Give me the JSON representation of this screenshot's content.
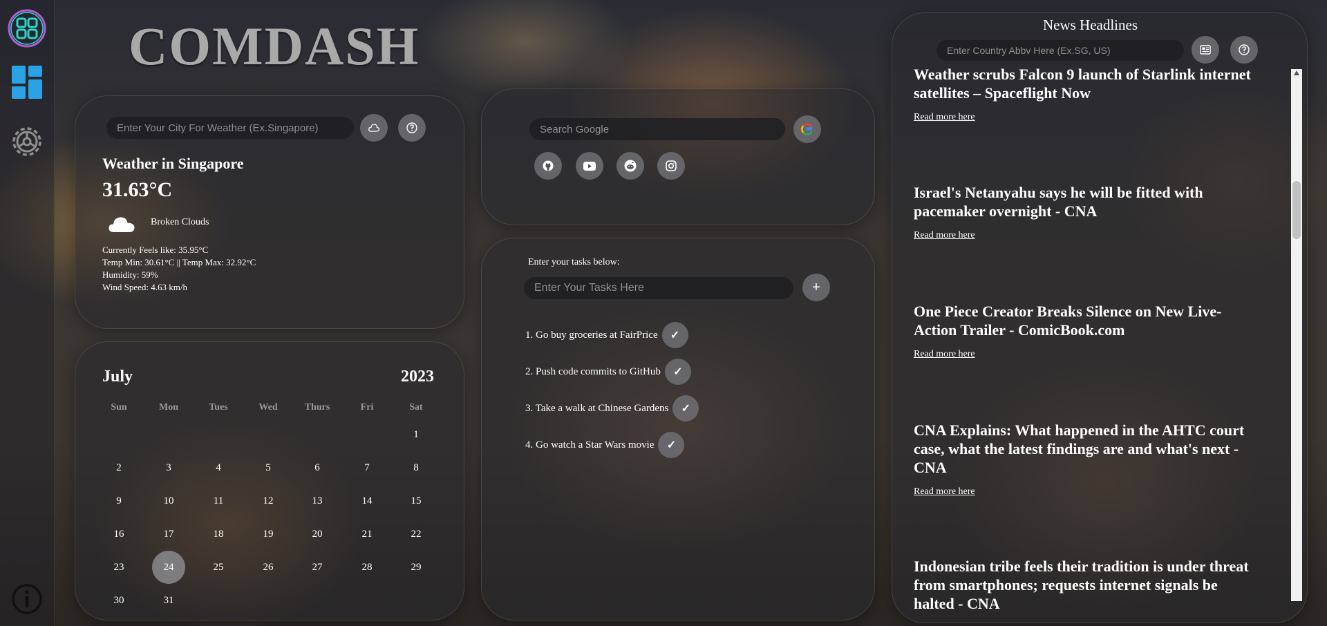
{
  "app": {
    "title": "COMDASH"
  },
  "sidebar": {
    "items": [
      {
        "name": "app-logo",
        "icon": "grid-logo-icon"
      },
      {
        "name": "dashboard",
        "icon": "dashboard-icon"
      },
      {
        "name": "settings",
        "icon": "gear-icon"
      },
      {
        "name": "info",
        "icon": "info-icon"
      }
    ]
  },
  "weather": {
    "placeholder": "Enter Your City For Weather (Ex.Singapore)",
    "title": "Weather in Singapore",
    "temp": "31.63°C",
    "condition": "Broken Clouds",
    "feels_like": "Currently Feels like: 35.95°C",
    "temp_range": "Temp Min: 30.61°C || Temp Max: 32.92°C",
    "humidity": "Humidity: 59%",
    "wind": "Wind Speed: 4.63 km/h"
  },
  "calendar": {
    "month": "July",
    "year": "2023",
    "weekdays": [
      "Sun",
      "Mon",
      "Tues",
      "Wed",
      "Thurs",
      "Fri",
      "Sat"
    ],
    "days": [
      "1",
      "2",
      "3",
      "4",
      "5",
      "6",
      "7",
      "8",
      "9",
      "10",
      "11",
      "12",
      "13",
      "14",
      "15",
      "16",
      "17",
      "18",
      "19",
      "20",
      "21",
      "22",
      "23",
      "24",
      "25",
      "26",
      "27",
      "28",
      "29",
      "30",
      "31"
    ],
    "today": "24"
  },
  "search": {
    "placeholder": "Search Google",
    "shortcuts": [
      "github-icon",
      "youtube-icon",
      "reddit-icon",
      "instagram-icon"
    ]
  },
  "tasks": {
    "label": "Enter your tasks below:",
    "placeholder": "Enter Your Tasks Here",
    "add_label": "+",
    "check_label": "✓",
    "items": [
      "1. Go buy groceries at FairPrice",
      "2. Push code commits to GitHub",
      "3. Take a walk at Chinese Gardens",
      "4. Go watch a Star Wars movie"
    ]
  },
  "news": {
    "title": "News Headlines",
    "placeholder": "Enter Country Abbv Here (Ex.SG, US)",
    "read_more": "Read more here",
    "articles": [
      "Weather scrubs Falcon 9 launch of Starlink internet satellites – Spaceflight Now",
      "Israel's Netanyahu says he will be fitted with pacemaker overnight - CNA",
      "One Piece Creator Breaks Silence on New Live-Action Trailer - ComicBook.com",
      "CNA Explains: What happened in the AHTC court case, what the latest findings are and what's next - CNA",
      "Indonesian tribe feels their tradition is under threat from smartphones; requests internet signals be halted - CNA"
    ]
  },
  "colors": {
    "accent_teal": "#2fd4c9",
    "accent_purple": "#b05cd6",
    "accent_blue": "#29a3e6"
  }
}
